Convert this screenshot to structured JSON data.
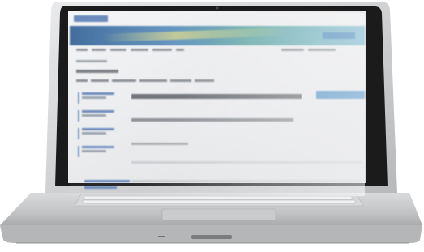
{
  "scene": {
    "subject": "laptop-photo",
    "screen_content_legible": false
  },
  "colors": {
    "banner_primary": "#2f5f94",
    "banner_secondary": "#5aa3a0",
    "accent_button": "#3f86bf",
    "laptop_body": "#c9cbcd",
    "bezel": "#1a1a1a"
  }
}
